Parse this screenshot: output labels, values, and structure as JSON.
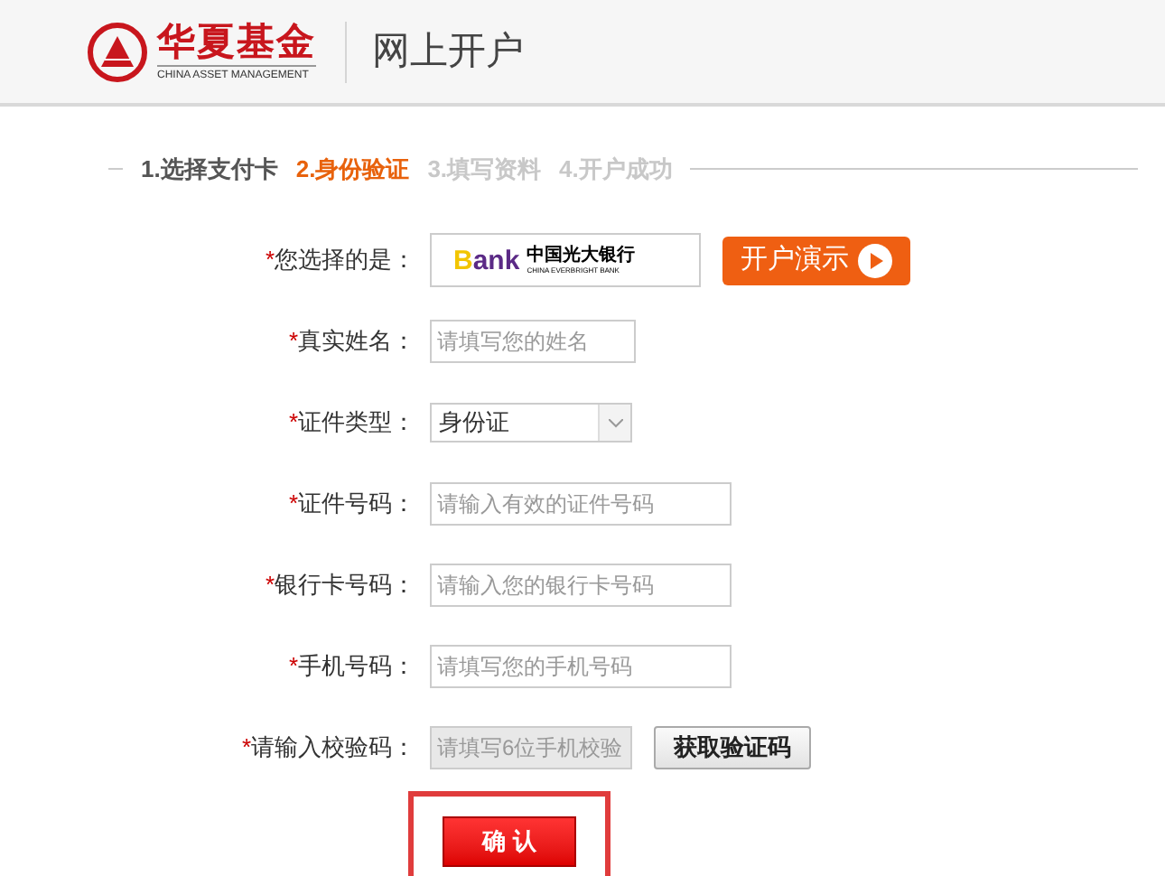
{
  "header": {
    "brand": "华夏基金",
    "brand_en": "CHINA ASSET MANAGEMENT",
    "title": "网上开户"
  },
  "steps": [
    {
      "label": "1.选择支付卡",
      "selected": false
    },
    {
      "label": "2.身份验证",
      "selected": true
    },
    {
      "label": "3.填写资料",
      "selected": false
    },
    {
      "label": "4.开户成功",
      "selected": false
    }
  ],
  "form": {
    "fields": [
      {
        "kind": "bank",
        "mark": "*",
        "label": "您选择的是：",
        "bank": {
          "initial": "B",
          "rest": "ank",
          "name_cn": "中国光大银行",
          "name_en": "CHINA EVERBRIGHT BANK"
        },
        "button": "开户演示"
      },
      {
        "kind": "text",
        "mark": "*",
        "label": "真实姓名：",
        "placeholder": "请填写您的姓名"
      },
      {
        "kind": "select",
        "mark": "*",
        "label": "证件类型：",
        "value": "身份证"
      },
      {
        "kind": "text",
        "mark": "*",
        "label": "证件号码：",
        "placeholder": "请输入有效的证件号码"
      },
      {
        "kind": "text",
        "mark": "*",
        "label": "银行卡号码：",
        "placeholder": "请输入您的银行卡号码"
      },
      {
        "kind": "text",
        "mark": "*",
        "label": "手机号码：",
        "placeholder": "请填写您的手机号码"
      },
      {
        "kind": "code",
        "mark": "*",
        "label": "请输入校验码：",
        "placeholder": "请填写6位手机校验",
        "disabled": true,
        "button": "获取验证码"
      }
    ],
    "submit": "确 认"
  }
}
